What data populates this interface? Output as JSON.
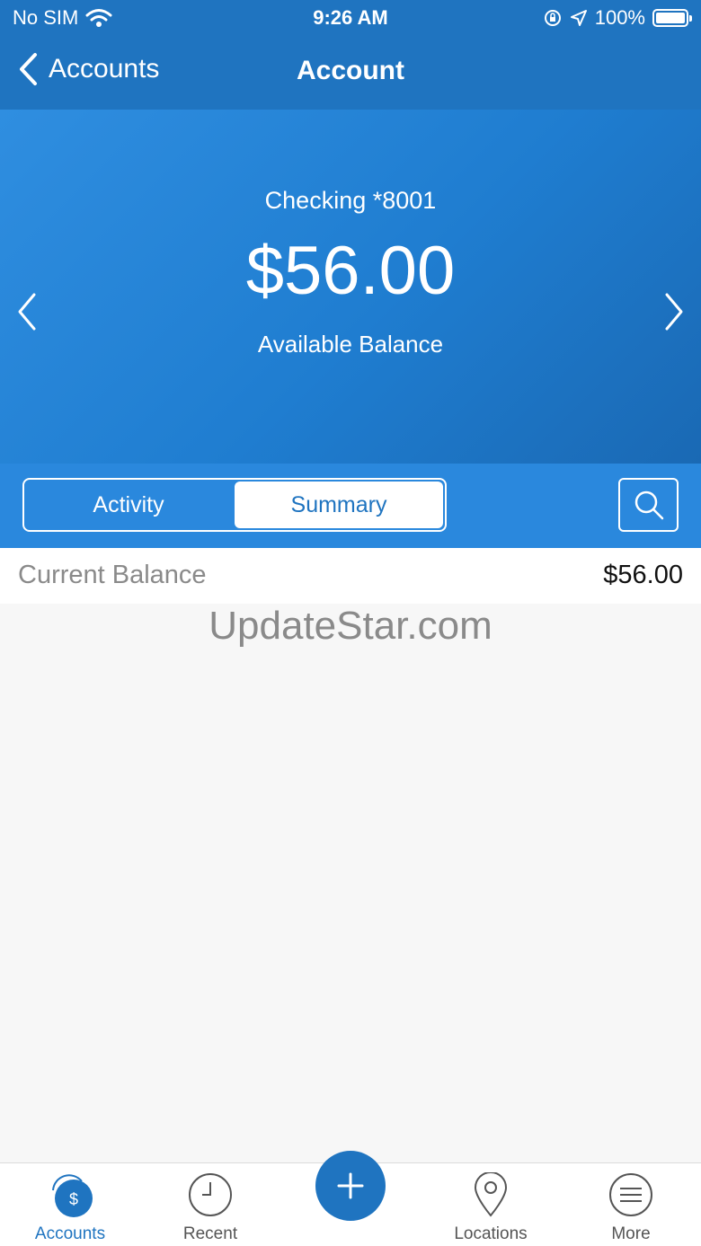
{
  "status_bar": {
    "carrier": "No SIM",
    "time": "9:26 AM",
    "battery_percent": "100%"
  },
  "nav": {
    "back_label": "Accounts",
    "title": "Account"
  },
  "account": {
    "name": "Checking *8001",
    "balance": "$56.00",
    "balance_label": "Available Balance"
  },
  "segments": {
    "activity": "Activity",
    "summary": "Summary",
    "selected": "Summary"
  },
  "summary": {
    "current_balance_label": "Current Balance",
    "current_balance_value": "$56.00"
  },
  "watermark": "UpdateStar.com",
  "tabbar": {
    "items": [
      {
        "label": "Accounts",
        "icon": "accounts-dollar-icon",
        "active": true
      },
      {
        "label": "Recent",
        "icon": "clock-icon",
        "active": false
      },
      {
        "label": "",
        "icon": "plus-icon",
        "active": false
      },
      {
        "label": "Locations",
        "icon": "location-pin-icon",
        "active": false
      },
      {
        "label": "More",
        "icon": "menu-icon",
        "active": false
      }
    ]
  },
  "colors": {
    "brand": "#1f74c0",
    "hero_gradient_start": "#2f8ee0",
    "hero_gradient_end": "#1a69b4",
    "background": "#f7f7f7"
  }
}
